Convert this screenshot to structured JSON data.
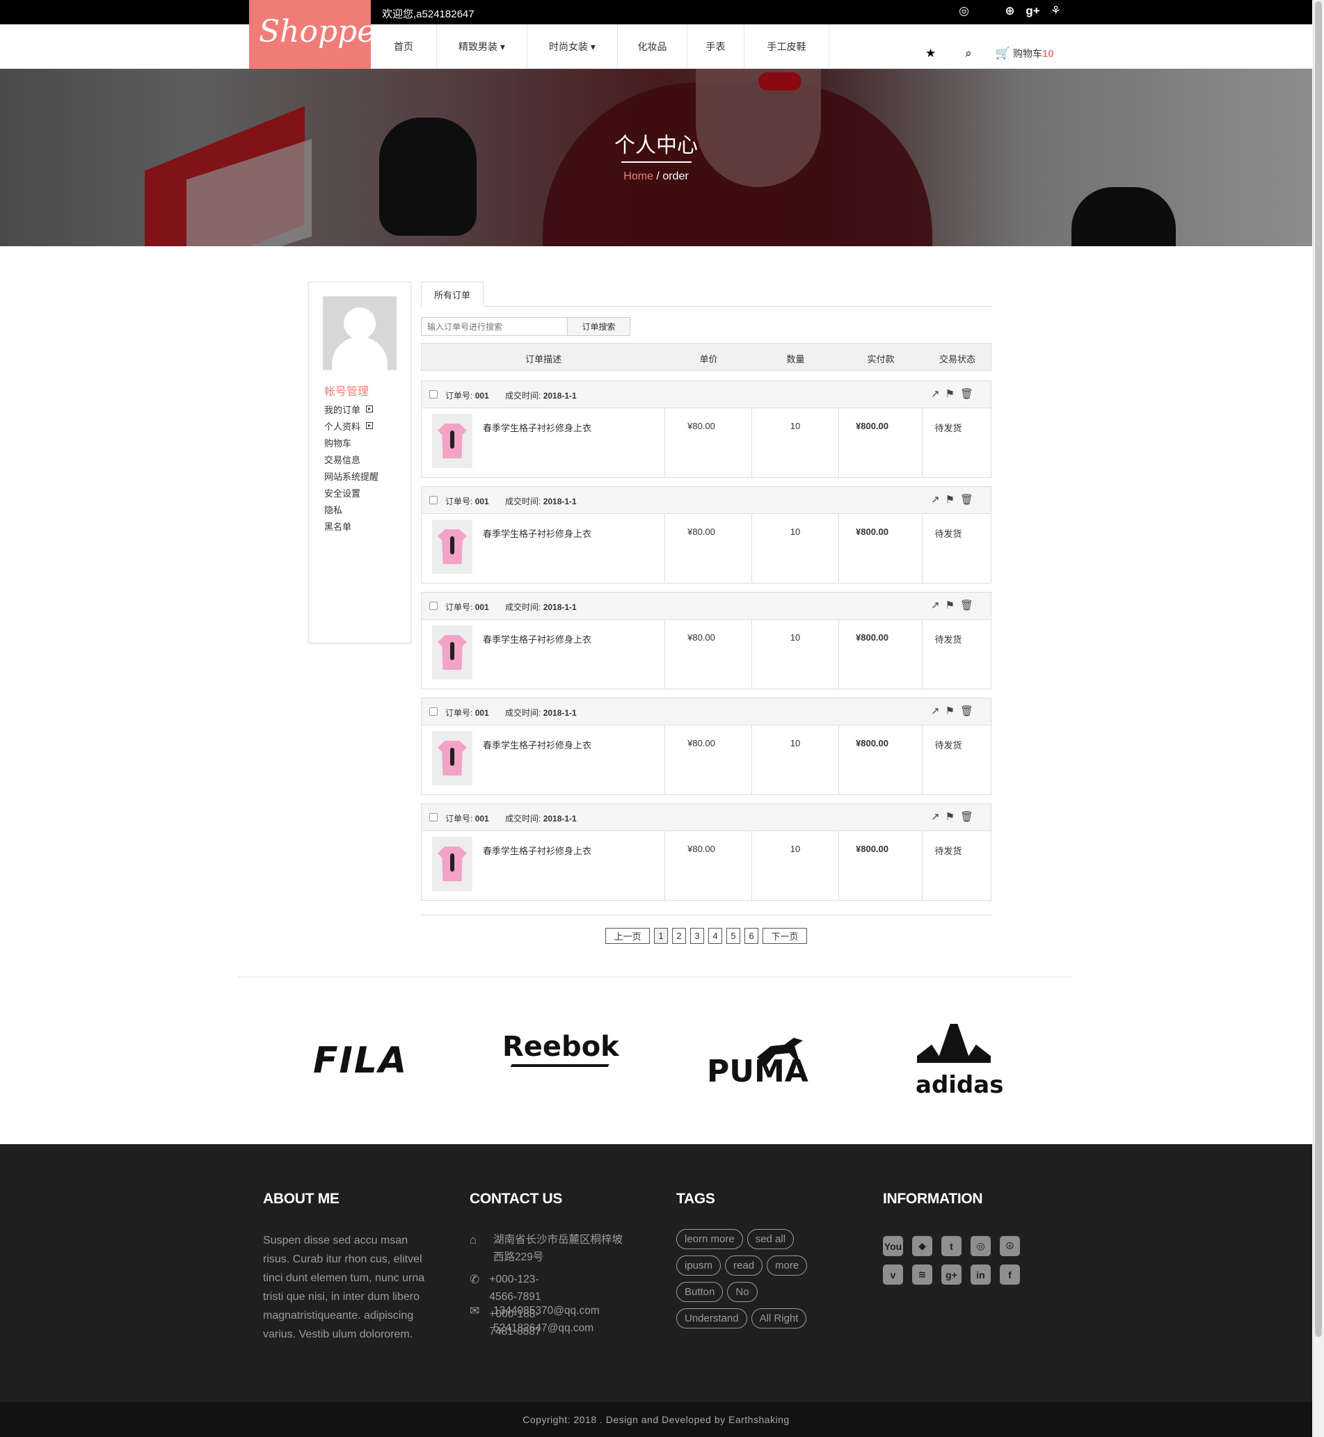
{
  "header": {
    "logo": "Shopper",
    "welcome": "欢迎您,a524182647",
    "social_icons": [
      "weibo-icon",
      "apple-icon",
      "dribbble-icon",
      "google-plus-icon",
      "tencent-icon"
    ],
    "social_glyphs": [
      "◎",
      "",
      "⊕",
      "g+",
      "⚘"
    ],
    "nav": [
      "首页",
      "精致男装 ▾",
      "时尚女装 ▾",
      "化妆品",
      "手表",
      "手工皮鞋"
    ],
    "cart_label": "购物车",
    "cart_count": "10",
    "accent_color": "#f07c78"
  },
  "banner": {
    "title": "个人中心",
    "crumb_home": "Home",
    "crumb_sep": " / ",
    "crumb_current": "order"
  },
  "sidebar": {
    "title": "帐号管理",
    "links": [
      "我的订单",
      "个人资料",
      "购物车",
      "交易信息",
      "网站系统提醒",
      "安全设置",
      "隐私",
      "黑名单"
    ]
  },
  "orders_panel": {
    "tab": "所有订单",
    "search_placeholder": "输入订单号进行搜索",
    "search_button": "订单搜索",
    "columns": [
      "订单描述",
      "单价",
      "数量",
      "实付款",
      "交易状态"
    ],
    "orders": [
      {
        "no_label": "订单号:",
        "no": "001",
        "time_label": "成交时间:",
        "time": "2018-1-1",
        "product": "春季学生格子衬衫修身上衣",
        "price": "¥80.00",
        "qty": "10",
        "paid": "¥800.00",
        "status": "待发货"
      },
      {
        "no_label": "订单号:",
        "no": "001",
        "time_label": "成交时间:",
        "time": "2018-1-1",
        "product": "春季学生格子衬衫修身上衣",
        "price": "¥80.00",
        "qty": "10",
        "paid": "¥800.00",
        "status": "待发货"
      },
      {
        "no_label": "订单号:",
        "no": "001",
        "time_label": "成交时间:",
        "time": "2018-1-1",
        "product": "春季学生格子衬衫修身上衣",
        "price": "¥80.00",
        "qty": "10",
        "paid": "¥800.00",
        "status": "待发货"
      },
      {
        "no_label": "订单号:",
        "no": "001",
        "time_label": "成交时间:",
        "time": "2018-1-1",
        "product": "春季学生格子衬衫修身上衣",
        "price": "¥80.00",
        "qty": "10",
        "paid": "¥800.00",
        "status": "待发货"
      },
      {
        "no_label": "订单号:",
        "no": "001",
        "time_label": "成交时间:",
        "time": "2018-1-1",
        "product": "春季学生格子衬衫修身上衣",
        "price": "¥80.00",
        "qty": "10",
        "paid": "¥800.00",
        "status": "待发货"
      }
    ],
    "pager": {
      "prev": "上一页",
      "pages": [
        "1",
        "2",
        "3",
        "4",
        "5",
        "6"
      ],
      "next": "下一页",
      "current": "1"
    }
  },
  "brands": [
    "FILA",
    "Reebok",
    "PUMA",
    "adidas"
  ],
  "footer": {
    "about_title": "ABOUT ME",
    "about_text": "Suspen disse sed accu msan risus. Curab itur rhon cus, elitvel tinci dunt elemen tum, nunc urna tristi que nisi, in inter dum libero magnatristiqueante. adipiscing varius. Vestib ulum dolororem.",
    "contact_title": "CONTACT US",
    "address": "湖南省长沙市岳麓区桐梓坡西路229号",
    "phone1": "+000-123-4566-7891",
    "phone2": "+000-188-7481-8887",
    "email1": "1344085370@qq.com",
    "email2": "524182647@qq.com",
    "tags_title": "TAGS",
    "tags": [
      "leorn more",
      "sed all",
      "ipusm",
      "read",
      "more",
      "Button",
      "No",
      "Understand",
      "All Right"
    ],
    "info_title": "INFORMATION",
    "info_icons": [
      "youtube-icon",
      "dropbox-icon",
      "twitter-icon",
      "weibo-icon",
      "peace-icon",
      "vimeo-icon",
      "rss-icon",
      "google-plus-icon",
      "linkedin-icon",
      "facebook-icon"
    ],
    "info_glyphs": [
      "You",
      "◆",
      "t",
      "◎",
      "☮",
      "v",
      "≋",
      "g+",
      "in",
      "f"
    ],
    "copyright": "Copyright: 2018 . Design and Developed by Earthshaking"
  }
}
